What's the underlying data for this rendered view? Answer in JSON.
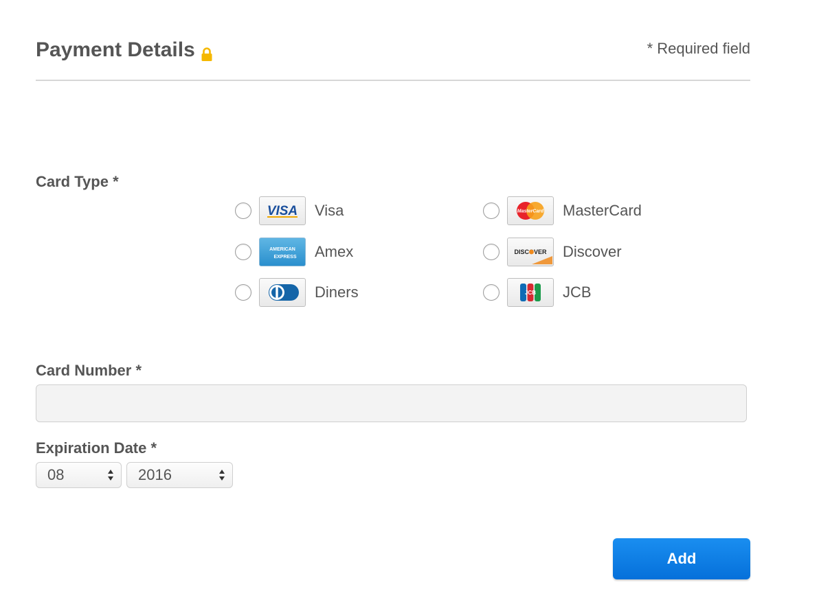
{
  "header": {
    "title": "Payment Details",
    "lock_icon": "lock-icon",
    "required_note": "* Required field",
    "accent": "#f5b800"
  },
  "card_type": {
    "label": "Card Type *",
    "options": [
      {
        "label": "Visa",
        "icon": "visa-icon",
        "logo_text": "VISA",
        "selected": false
      },
      {
        "label": "MasterCard",
        "icon": "mastercard-icon",
        "logo_text": "MasterCard",
        "selected": false
      },
      {
        "label": "Amex",
        "icon": "amex-icon",
        "logo_text": "AMERICAN EXPRESS",
        "selected": false
      },
      {
        "label": "Discover",
        "icon": "discover-icon",
        "logo_text": "DISCOVER",
        "selected": false
      },
      {
        "label": "Diners",
        "icon": "diners-icon",
        "selected": false
      },
      {
        "label": "JCB",
        "icon": "jcb-icon",
        "logo_text": "JCB",
        "selected": false
      }
    ]
  },
  "card_number": {
    "label": "Card Number *",
    "value": "",
    "placeholder": ""
  },
  "expiration": {
    "label": "Expiration Date *",
    "month": "08",
    "year": "2016"
  },
  "actions": {
    "add_label": "Add",
    "button_color": "#0a7be4"
  }
}
